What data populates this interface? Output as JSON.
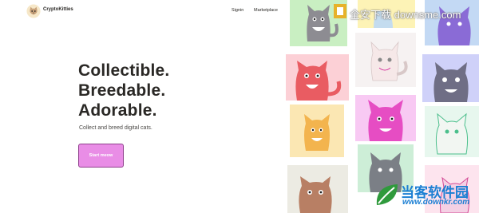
{
  "header": {
    "brand": "CryptoKitties",
    "nav": {
      "signin": "Signin",
      "marketplace": "Marketplace"
    }
  },
  "hero": {
    "line1": "Collectible.",
    "line2": "Breedable.",
    "line3": "Adorable.",
    "subtitle": "Collect and breed digital cats.",
    "cta": "Start meow"
  },
  "watermark": {
    "top": "全安下载 downsme.com",
    "bottom_cn": "当客软件园",
    "bottom_url": "www.downkr.com"
  },
  "colors": {
    "accent": "#e98de6",
    "cta_border": "#8e3f8b",
    "text": "#2a2825"
  }
}
